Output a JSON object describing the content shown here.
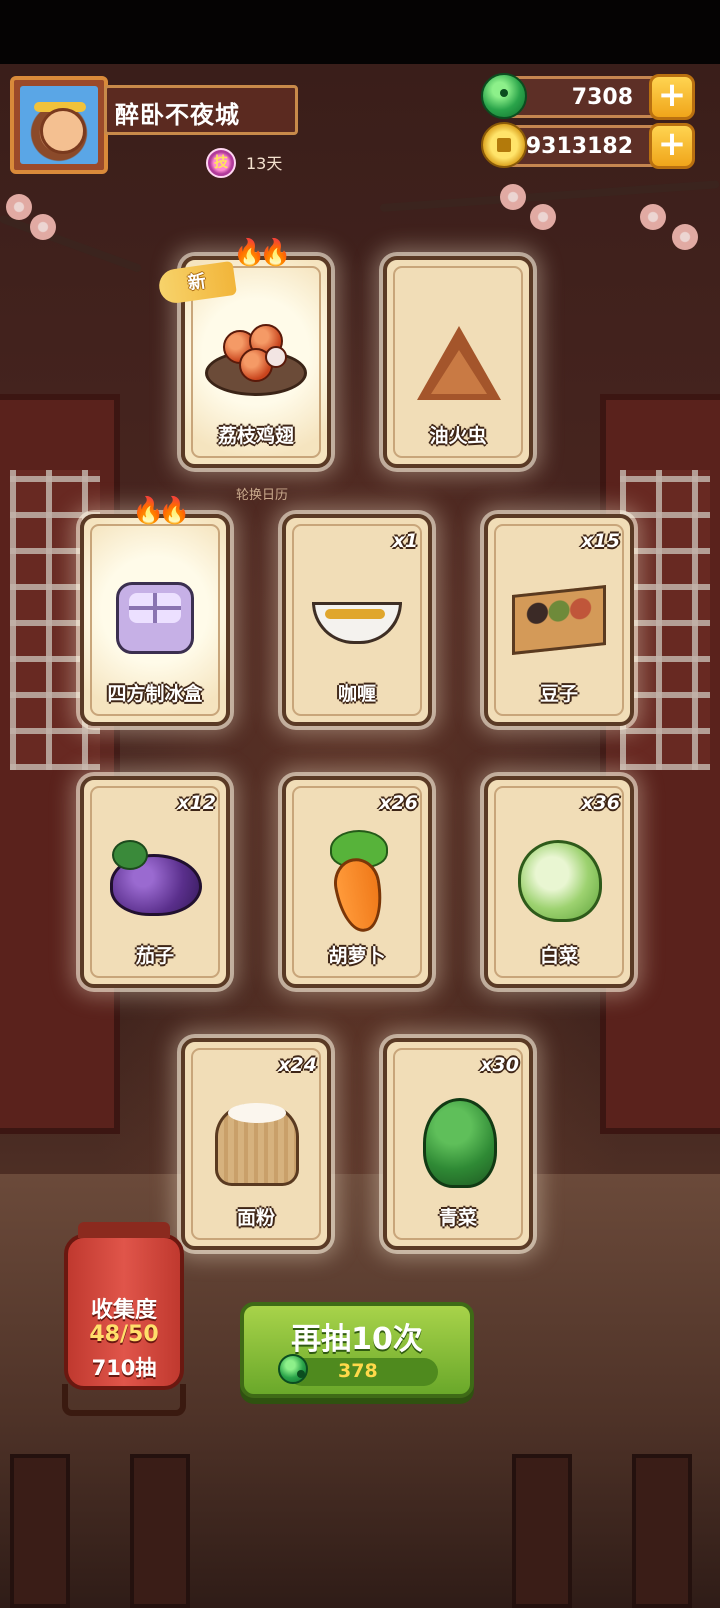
{
  "player": {
    "name": "醉卧不夜城",
    "badge_label": "技",
    "days": "13天"
  },
  "resources": {
    "jade": "7308",
    "coins": "9313182"
  },
  "rotation_label": "轮换日历",
  "new_tag": "新",
  "cards": [
    {
      "name": "荔枝鸡翅",
      "count": "",
      "icon": "chicken-wings-dish-icon",
      "is_new": true,
      "flames": 2
    },
    {
      "name": "油火虫",
      "count": "",
      "icon": "firefly-pastry-icon",
      "is_new": false,
      "flames": 0
    },
    {
      "name": "四方制冰盒",
      "count": "",
      "icon": "ice-box-icon",
      "is_new": false,
      "flames": 2
    },
    {
      "name": "咖喱",
      "count": "x1",
      "icon": "curry-gravy-boat-icon",
      "is_new": false,
      "flames": 0
    },
    {
      "name": "豆子",
      "count": "x15",
      "icon": "beans-box-icon",
      "is_new": false,
      "flames": 0
    },
    {
      "name": "茄子",
      "count": "x12",
      "icon": "eggplant-icon",
      "is_new": false,
      "flames": 0
    },
    {
      "name": "胡萝卜",
      "count": "x26",
      "icon": "carrot-icon",
      "is_new": false,
      "flames": 0
    },
    {
      "name": "白菜",
      "count": "x36",
      "icon": "napa-cabbage-icon",
      "is_new": false,
      "flames": 0
    },
    {
      "name": "面粉",
      "count": "x24",
      "icon": "flour-sack-icon",
      "is_new": false,
      "flames": 0
    },
    {
      "name": "青菜",
      "count": "x30",
      "icon": "bok-choy-icon",
      "is_new": false,
      "flames": 0
    }
  ],
  "collection": {
    "title": "收集度",
    "progress": "48/50",
    "draws": "710抽"
  },
  "draw_button": {
    "label": "再抽10次",
    "cost": "378"
  },
  "colors": {
    "card_bg": "#f1ddb7",
    "draw_green": "#6aa82a",
    "lantern_red": "#c0392f"
  }
}
